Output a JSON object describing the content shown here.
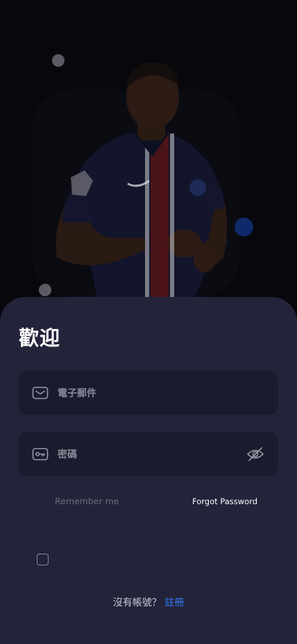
{
  "login": {
    "title": "歡迎",
    "email_placeholder": "電子郵件",
    "password_placeholder": "密碼",
    "remember_label": "Remember me",
    "forgot_label": "Forgot Password",
    "no_account_text": "沒有帳號？",
    "signup_link": "註冊"
  },
  "icons": {
    "email": "mail-icon",
    "password": "key-icon",
    "visibility": "eye-off-icon"
  },
  "colors": {
    "background": "#07070c",
    "sheet": "#23233a",
    "field": "#1b1b2e",
    "link": "#2f7cf6"
  }
}
